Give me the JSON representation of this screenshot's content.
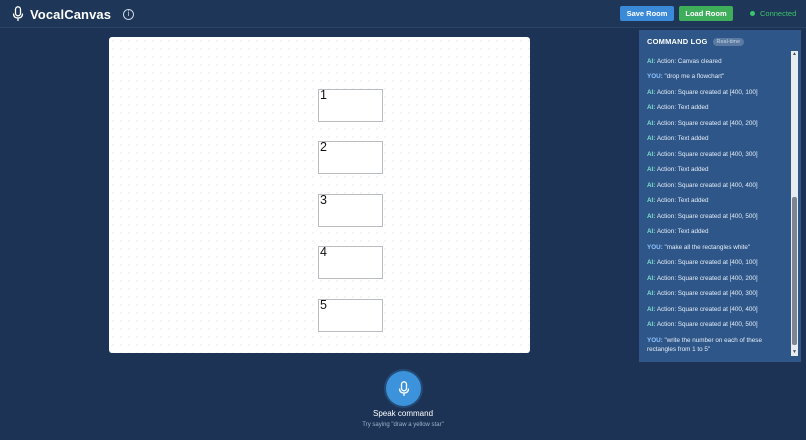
{
  "header": {
    "title": "VocalCanvas",
    "save_label": "Save Room",
    "load_label": "Load Room",
    "status": "Connected",
    "info_glyph": "i"
  },
  "colors": {
    "background": "#1c3355",
    "panel": "#2e5688",
    "save_button": "#3b8ad8",
    "load_button": "#3fae5a",
    "status_green": "#3cc46b",
    "mic_button": "#3d92dc",
    "shape_fill": "#ffffff"
  },
  "icons": {
    "header_mic": "microphone-icon",
    "info": "info-icon",
    "speak": "microphone-icon"
  },
  "canvas": {
    "shapes": [
      {
        "label": "1"
      },
      {
        "label": "2"
      },
      {
        "label": "3"
      },
      {
        "label": "4"
      },
      {
        "label": "5"
      }
    ]
  },
  "log": {
    "title": "COMMAND LOG",
    "badge": "Real-time",
    "entries": [
      {
        "role": "AI:",
        "text": "Action: Canvas cleared"
      },
      {
        "role": "YOU:",
        "text": "\"drop me a flowchart\""
      },
      {
        "role": "AI:",
        "text": "Action: Square created at [400, 100]"
      },
      {
        "role": "AI:",
        "text": "Action: Text added"
      },
      {
        "role": "AI:",
        "text": "Action: Square created at [400, 200]"
      },
      {
        "role": "AI:",
        "text": "Action: Text added"
      },
      {
        "role": "AI:",
        "text": "Action: Square created at [400, 300]"
      },
      {
        "role": "AI:",
        "text": "Action: Text added"
      },
      {
        "role": "AI:",
        "text": "Action: Square created at [400, 400]"
      },
      {
        "role": "AI:",
        "text": "Action: Text added"
      },
      {
        "role": "AI:",
        "text": "Action: Square created at [400, 500]"
      },
      {
        "role": "AI:",
        "text": "Action: Text added"
      },
      {
        "role": "YOU:",
        "text": "\"make all the rectangles white\""
      },
      {
        "role": "AI:",
        "text": "Action: Square created at [400, 100]"
      },
      {
        "role": "AI:",
        "text": "Action: Square created at [400, 200]"
      },
      {
        "role": "AI:",
        "text": "Action: Square created at [400, 300]"
      },
      {
        "role": "AI:",
        "text": "Action: Square created at [400, 400]"
      },
      {
        "role": "AI:",
        "text": "Action: Square created at [400, 500]"
      },
      {
        "role": "YOU:",
        "text": "\"write the number on each of these rectangles from 1 to 5\""
      }
    ]
  },
  "bottom": {
    "speak_label": "Speak command",
    "hint": "Try saying \"draw a yellow star\""
  }
}
